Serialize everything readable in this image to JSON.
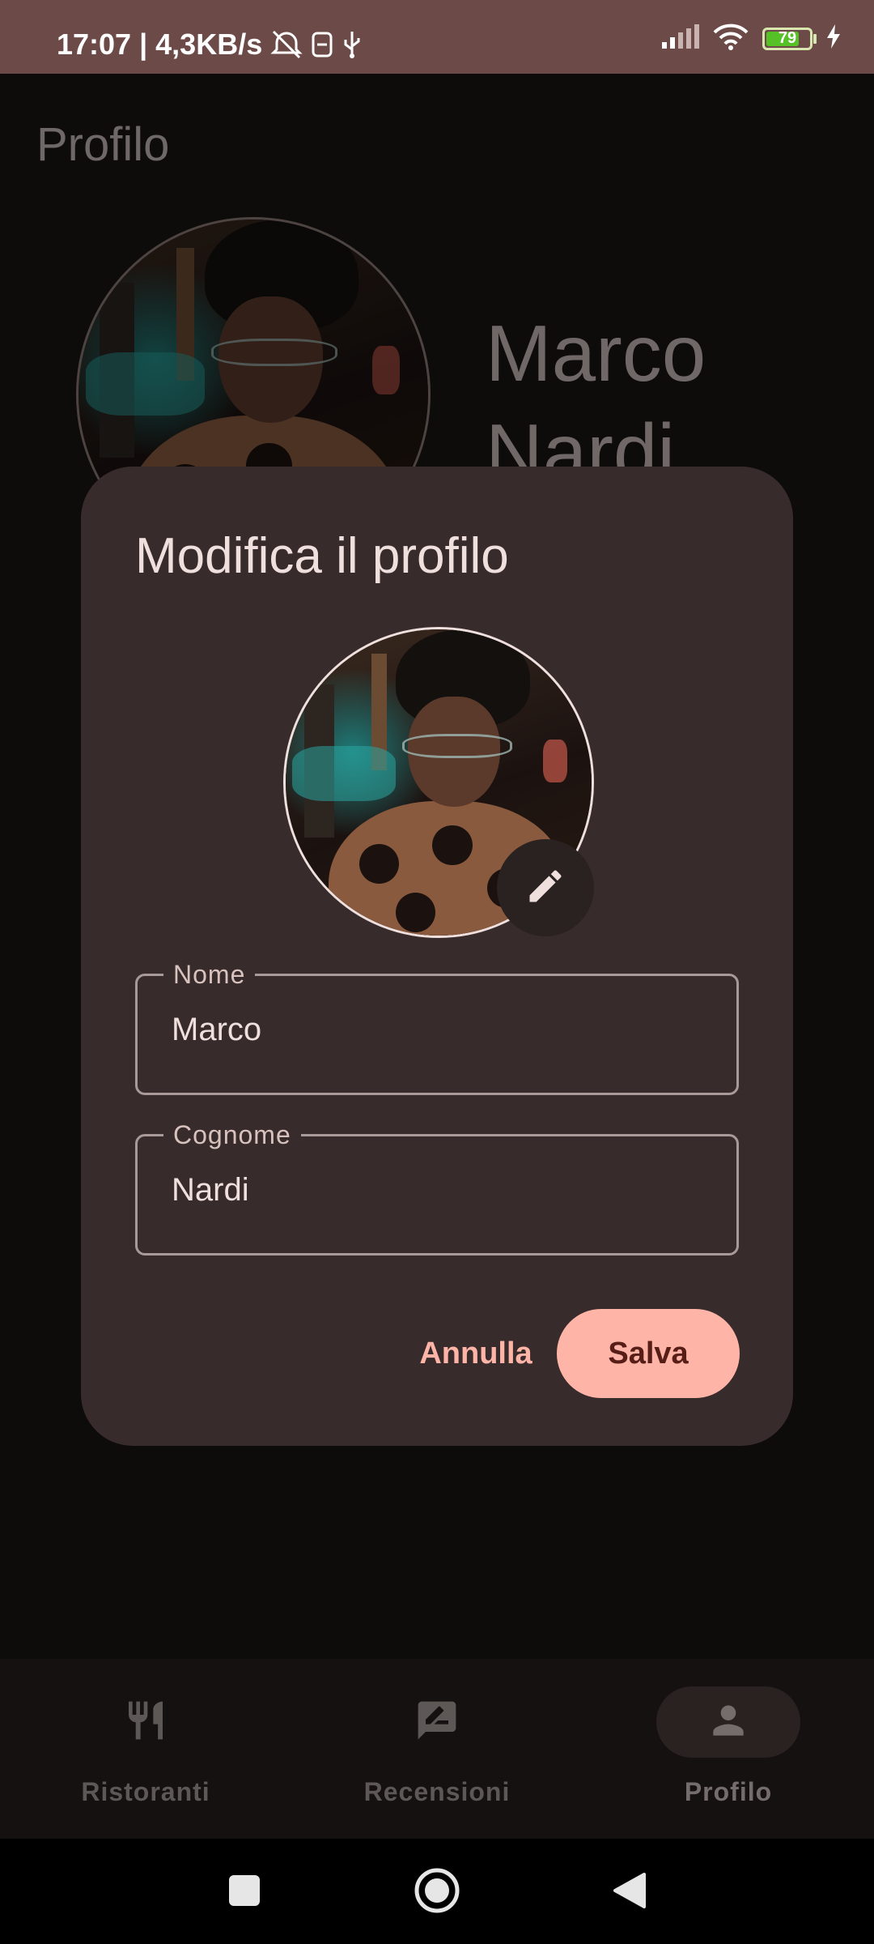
{
  "status_bar": {
    "time": "17:07",
    "separator": "|",
    "net_speed": "4,3KB/s",
    "battery_level": "79",
    "battery_fraction": 0.79,
    "icons": [
      "alarm-off-icon",
      "sim-icon",
      "usb-icon",
      "signal-icon",
      "wifi-icon",
      "battery-icon",
      "charging-icon"
    ]
  },
  "page": {
    "title": "Profilo",
    "user_first_name": "Marco",
    "user_last_name": "Nardi"
  },
  "dialog": {
    "title": "Modifica il profilo",
    "edit_icon": "pencil-icon",
    "fields": {
      "first_name": {
        "label": "Nome",
        "value": "Marco"
      },
      "last_name": {
        "label": "Cognome",
        "value": "Nardi"
      }
    },
    "buttons": {
      "cancel": "Annulla",
      "save": "Salva"
    }
  },
  "bottom_nav": {
    "items": [
      {
        "label": "Ristoranti",
        "icon": "fork-knife-icon",
        "active": false
      },
      {
        "label": "Recensioni",
        "icon": "review-icon",
        "active": false
      },
      {
        "label": "Profilo",
        "icon": "person-icon",
        "active": true
      }
    ]
  },
  "system_nav": [
    "recents-button",
    "home-button",
    "back-button"
  ],
  "colors": {
    "status_bar": "#6b4a48",
    "dialog_bg": "#382b2b",
    "accent": "#ffb4a8",
    "accent_text": "#561e16",
    "background": "#0e0b0b"
  }
}
